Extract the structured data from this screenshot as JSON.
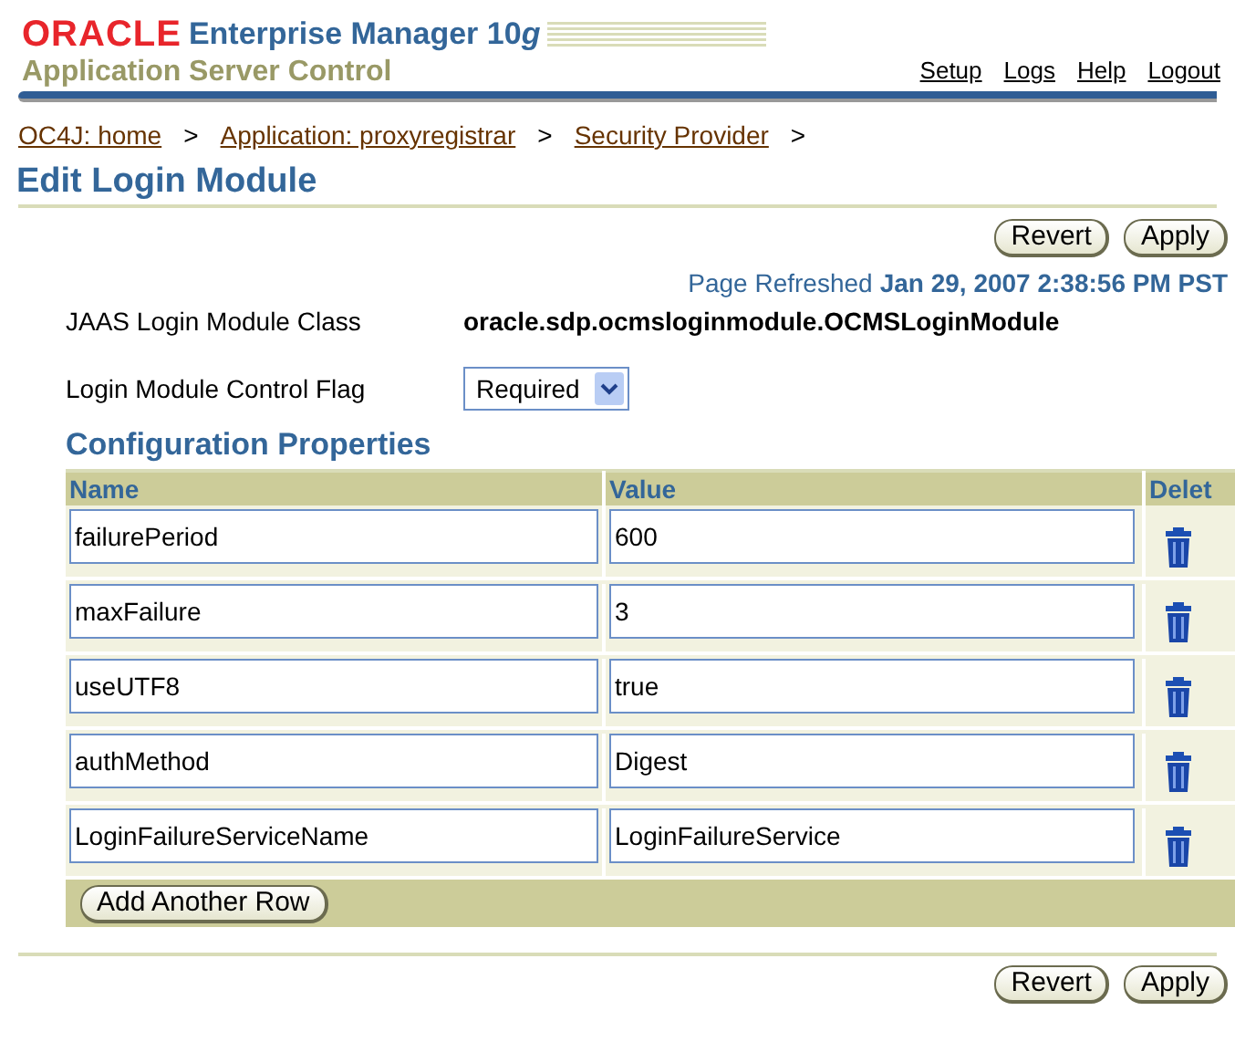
{
  "header": {
    "brand": "ORACLE",
    "product": "Enterprise Manager 10",
    "product_suffix": "g",
    "subtitle": "Application Server Control",
    "links": [
      "Setup",
      "Logs",
      "Help",
      "Logout"
    ]
  },
  "breadcrumbs": [
    "OC4J: home",
    "Application: proxyregistrar",
    "Security Provider"
  ],
  "breadcrumb_separator": ">",
  "page_title": "Edit Login Module",
  "top_buttons": [
    "Revert",
    "Apply"
  ],
  "refresh": {
    "label": "Page Refreshed",
    "timestamp": "Jan 29, 2007 2:38:56 PM PST"
  },
  "class_field": {
    "label": "JAAS Login Module Class",
    "value": "oracle.sdp.ocmsloginmodule.OCMSLoginModule"
  },
  "flag_field": {
    "label": "Login Module Control Flag",
    "value": "Required"
  },
  "section_title": "Configuration Properties",
  "table": {
    "columns": [
      "Name",
      "Value",
      "Delet"
    ],
    "rows": [
      {
        "name": "failurePeriod",
        "value": "600"
      },
      {
        "name": "maxFailure",
        "value": "3"
      },
      {
        "name": "useUTF8",
        "value": "true"
      },
      {
        "name": "authMethod",
        "value": "Digest"
      },
      {
        "name": "LoginFailureServiceName",
        "value": "LoginFailureService"
      }
    ],
    "add_button": "Add Another Row"
  },
  "bottom_buttons": [
    "Revert",
    "Apply"
  ]
}
